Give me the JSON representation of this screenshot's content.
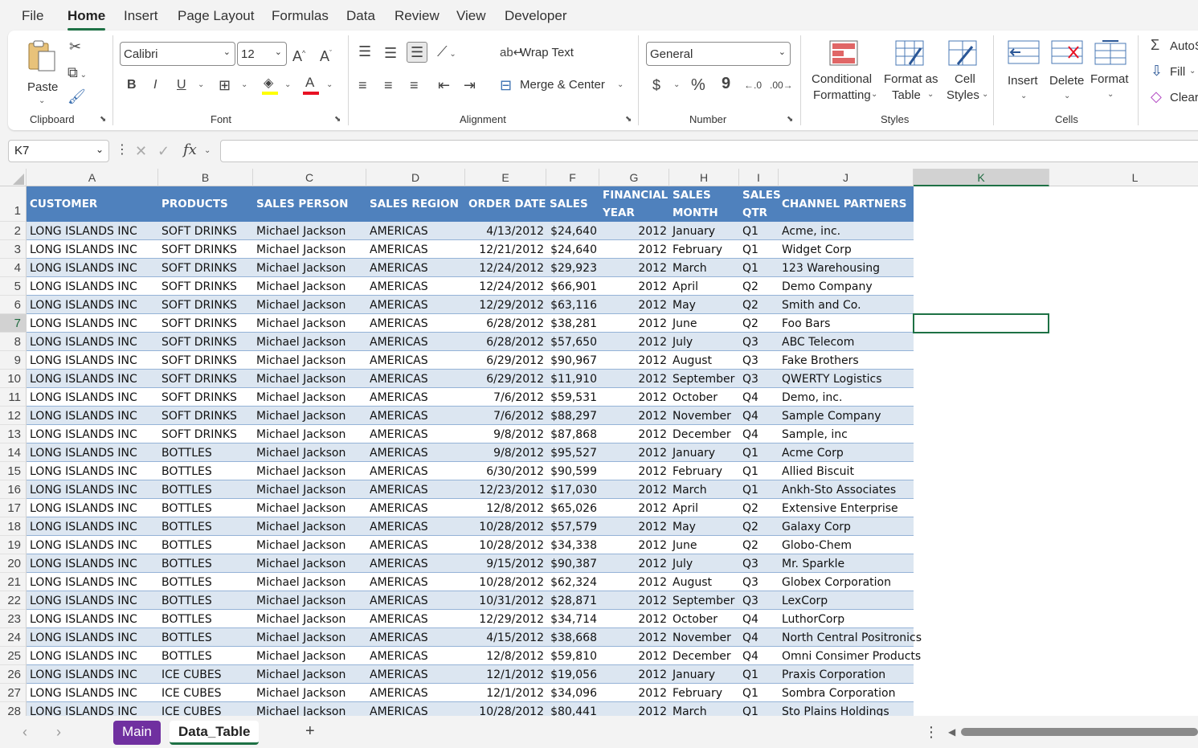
{
  "menu": {
    "tabs": [
      "File",
      "Home",
      "Insert",
      "Page Layout",
      "Formulas",
      "Data",
      "Review",
      "View",
      "Developer"
    ],
    "active": "Home"
  },
  "ribbon": {
    "clipboard": {
      "paste_label": "Paste",
      "group_label": "Clipboard"
    },
    "font": {
      "name": "Calibri",
      "size": "12",
      "group_label": "Font",
      "bold": "B",
      "italic": "I",
      "underline": "U",
      "fill_color": "#ffff00",
      "font_color": "#e81123"
    },
    "alignment": {
      "wrap_text": "Wrap Text",
      "merge_center": "Merge & Center",
      "group_label": "Alignment"
    },
    "number": {
      "format": "General",
      "currency": "$",
      "percent": "%",
      "comma": "9",
      "group_label": "Number"
    },
    "styles": {
      "conditional_1": "Conditional",
      "conditional_2": "Formatting",
      "format_as_1": "Format as",
      "format_as_2": "Table",
      "cell_1": "Cell",
      "cell_2": "Styles",
      "group_label": "Styles"
    },
    "cells": {
      "insert": "Insert",
      "delete": "Delete",
      "format": "Format",
      "group_label": "Cells"
    },
    "editing": {
      "autosum": "AutoS",
      "fill": "Fill",
      "clear": "Clear"
    }
  },
  "formula_bar": {
    "name_box": "K7",
    "fx": "fx",
    "value": ""
  },
  "columns": [
    "A",
    "B",
    "C",
    "D",
    "E",
    "F",
    "G",
    "H",
    "I",
    "J",
    "K",
    "L"
  ],
  "selected_cell": {
    "col": "K",
    "row": 7
  },
  "table": {
    "header_color": "#4f81bd",
    "band_color": "#dce6f1",
    "headers": [
      {
        "l1": "CUSTOMER",
        "l2": ""
      },
      {
        "l1": "PRODUCTS",
        "l2": ""
      },
      {
        "l1": "SALES PERSON",
        "l2": ""
      },
      {
        "l1": "SALES REGION",
        "l2": ""
      },
      {
        "l1": "ORDER DATE",
        "l2": ""
      },
      {
        "l1": "SALES",
        "l2": ""
      },
      {
        "l1": "FINANCIAL",
        "l2": "YEAR"
      },
      {
        "l1": "SALES",
        "l2": "MONTH"
      },
      {
        "l1": "SALES",
        "l2": "QTR"
      },
      {
        "l1": "CHANNEL PARTNERS",
        "l2": ""
      }
    ],
    "rows": [
      [
        "LONG ISLANDS INC",
        "SOFT DRINKS",
        "Michael Jackson",
        "AMERICAS",
        "4/13/2012",
        "$24,640",
        "2012",
        "January",
        "Q1",
        "Acme, inc."
      ],
      [
        "LONG ISLANDS INC",
        "SOFT DRINKS",
        "Michael Jackson",
        "AMERICAS",
        "12/21/2012",
        "$24,640",
        "2012",
        "February",
        "Q1",
        "Widget Corp"
      ],
      [
        "LONG ISLANDS INC",
        "SOFT DRINKS",
        "Michael Jackson",
        "AMERICAS",
        "12/24/2012",
        "$29,923",
        "2012",
        "March",
        "Q1",
        "123 Warehousing"
      ],
      [
        "LONG ISLANDS INC",
        "SOFT DRINKS",
        "Michael Jackson",
        "AMERICAS",
        "12/24/2012",
        "$66,901",
        "2012",
        "April",
        "Q2",
        "Demo Company"
      ],
      [
        "LONG ISLANDS INC",
        "SOFT DRINKS",
        "Michael Jackson",
        "AMERICAS",
        "12/29/2012",
        "$63,116",
        "2012",
        "May",
        "Q2",
        "Smith and Co."
      ],
      [
        "LONG ISLANDS INC",
        "SOFT DRINKS",
        "Michael Jackson",
        "AMERICAS",
        "6/28/2012",
        "$38,281",
        "2012",
        "June",
        "Q2",
        "Foo Bars"
      ],
      [
        "LONG ISLANDS INC",
        "SOFT DRINKS",
        "Michael Jackson",
        "AMERICAS",
        "6/28/2012",
        "$57,650",
        "2012",
        "July",
        "Q3",
        "ABC Telecom"
      ],
      [
        "LONG ISLANDS INC",
        "SOFT DRINKS",
        "Michael Jackson",
        "AMERICAS",
        "6/29/2012",
        "$90,967",
        "2012",
        "August",
        "Q3",
        "Fake Brothers"
      ],
      [
        "LONG ISLANDS INC",
        "SOFT DRINKS",
        "Michael Jackson",
        "AMERICAS",
        "6/29/2012",
        "$11,910",
        "2012",
        "September",
        "Q3",
        "QWERTY Logistics"
      ],
      [
        "LONG ISLANDS INC",
        "SOFT DRINKS",
        "Michael Jackson",
        "AMERICAS",
        "7/6/2012",
        "$59,531",
        "2012",
        "October",
        "Q4",
        "Demo, inc."
      ],
      [
        "LONG ISLANDS INC",
        "SOFT DRINKS",
        "Michael Jackson",
        "AMERICAS",
        "7/6/2012",
        "$88,297",
        "2012",
        "November",
        "Q4",
        "Sample Company"
      ],
      [
        "LONG ISLANDS INC",
        "SOFT DRINKS",
        "Michael Jackson",
        "AMERICAS",
        "9/8/2012",
        "$87,868",
        "2012",
        "December",
        "Q4",
        "Sample, inc"
      ],
      [
        "LONG ISLANDS INC",
        "BOTTLES",
        "Michael Jackson",
        "AMERICAS",
        "9/8/2012",
        "$95,527",
        "2012",
        "January",
        "Q1",
        "Acme Corp"
      ],
      [
        "LONG ISLANDS INC",
        "BOTTLES",
        "Michael Jackson",
        "AMERICAS",
        "6/30/2012",
        "$90,599",
        "2012",
        "February",
        "Q1",
        "Allied Biscuit"
      ],
      [
        "LONG ISLANDS INC",
        "BOTTLES",
        "Michael Jackson",
        "AMERICAS",
        "12/23/2012",
        "$17,030",
        "2012",
        "March",
        "Q1",
        "Ankh-Sto Associates"
      ],
      [
        "LONG ISLANDS INC",
        "BOTTLES",
        "Michael Jackson",
        "AMERICAS",
        "12/8/2012",
        "$65,026",
        "2012",
        "April",
        "Q2",
        "Extensive Enterprise"
      ],
      [
        "LONG ISLANDS INC",
        "BOTTLES",
        "Michael Jackson",
        "AMERICAS",
        "10/28/2012",
        "$57,579",
        "2012",
        "May",
        "Q2",
        "Galaxy Corp"
      ],
      [
        "LONG ISLANDS INC",
        "BOTTLES",
        "Michael Jackson",
        "AMERICAS",
        "10/28/2012",
        "$34,338",
        "2012",
        "June",
        "Q2",
        "Globo-Chem"
      ],
      [
        "LONG ISLANDS INC",
        "BOTTLES",
        "Michael Jackson",
        "AMERICAS",
        "9/15/2012",
        "$90,387",
        "2012",
        "July",
        "Q3",
        "Mr. Sparkle"
      ],
      [
        "LONG ISLANDS INC",
        "BOTTLES",
        "Michael Jackson",
        "AMERICAS",
        "10/28/2012",
        "$62,324",
        "2012",
        "August",
        "Q3",
        "Globex Corporation"
      ],
      [
        "LONG ISLANDS INC",
        "BOTTLES",
        "Michael Jackson",
        "AMERICAS",
        "10/31/2012",
        "$28,871",
        "2012",
        "September",
        "Q3",
        "LexCorp"
      ],
      [
        "LONG ISLANDS INC",
        "BOTTLES",
        "Michael Jackson",
        "AMERICAS",
        "12/29/2012",
        "$34,714",
        "2012",
        "October",
        "Q4",
        "LuthorCorp"
      ],
      [
        "LONG ISLANDS INC",
        "BOTTLES",
        "Michael Jackson",
        "AMERICAS",
        "4/15/2012",
        "$38,668",
        "2012",
        "November",
        "Q4",
        "North Central Positronics"
      ],
      [
        "LONG ISLANDS INC",
        "BOTTLES",
        "Michael Jackson",
        "AMERICAS",
        "12/8/2012",
        "$59,810",
        "2012",
        "December",
        "Q4",
        "Omni Consimer Products"
      ],
      [
        "LONG ISLANDS INC",
        "ICE CUBES",
        "Michael Jackson",
        "AMERICAS",
        "12/1/2012",
        "$19,056",
        "2012",
        "January",
        "Q1",
        "Praxis Corporation"
      ],
      [
        "LONG ISLANDS INC",
        "ICE CUBES",
        "Michael Jackson",
        "AMERICAS",
        "12/1/2012",
        "$34,096",
        "2012",
        "February",
        "Q1",
        "Sombra Corporation"
      ],
      [
        "LONG ISLANDS INC",
        "ICE CUBES",
        "Michael Jackson",
        "AMERICAS",
        "10/28/2012",
        "$80,441",
        "2012",
        "March",
        "Q1",
        "Sto Plains Holdings"
      ]
    ]
  },
  "sheet_tabs": {
    "tabs": [
      "Main",
      "Data_Table"
    ],
    "active": "Data_Table",
    "main_color": "#7030a0",
    "add": "+"
  }
}
